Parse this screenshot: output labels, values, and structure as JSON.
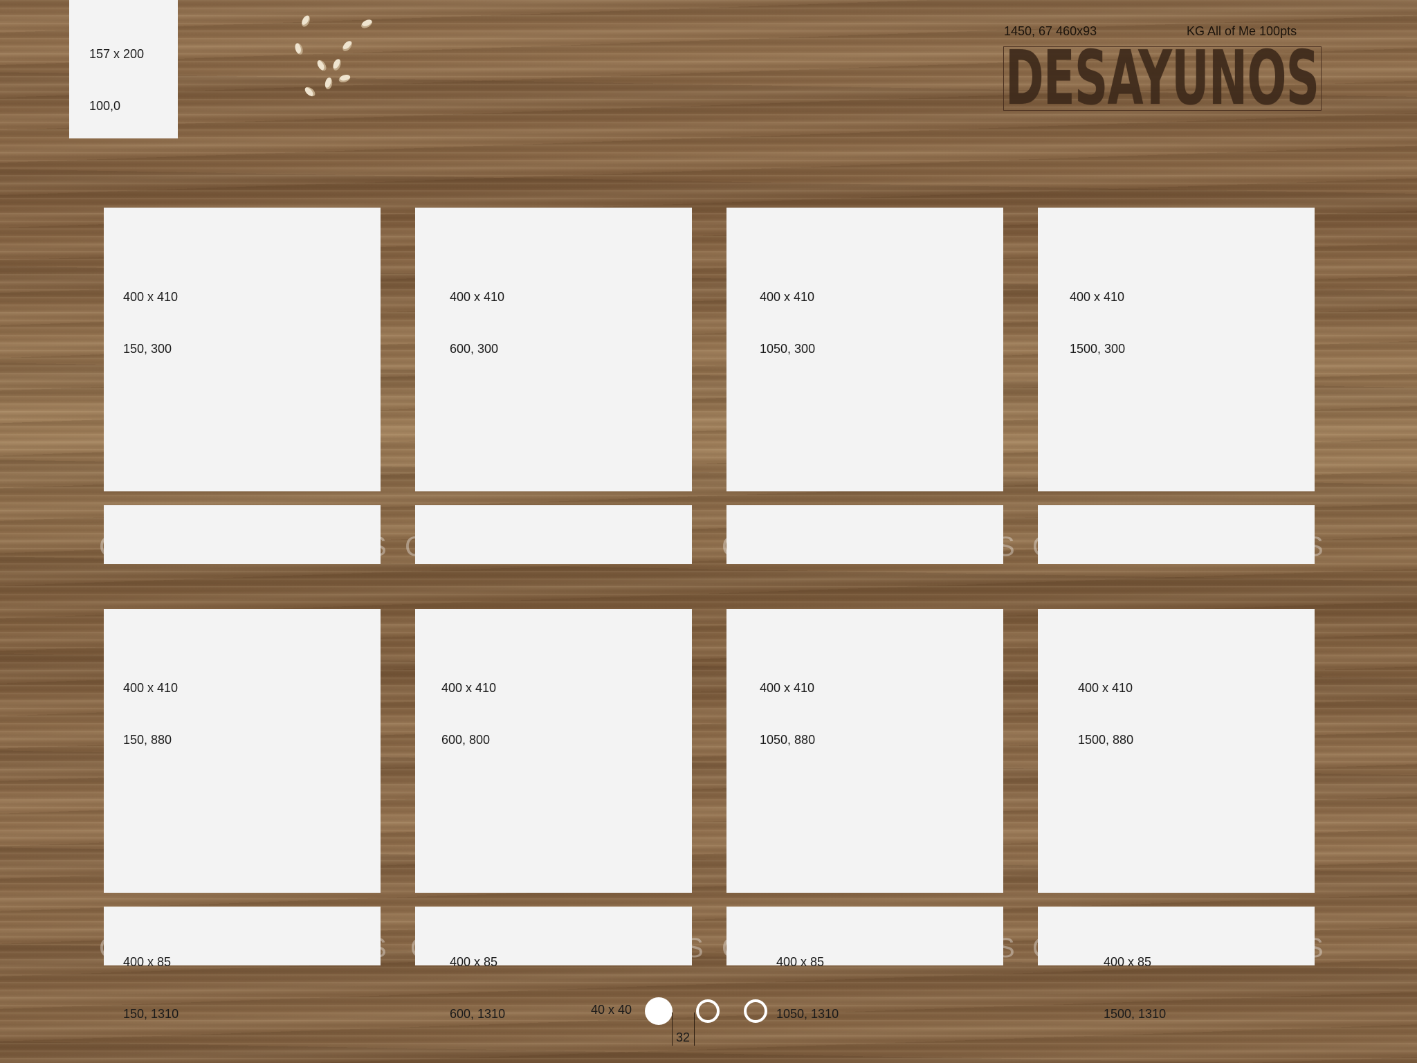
{
  "corner_placeholder": {
    "line1": "157 x 200",
    "line2": "100,0"
  },
  "header": {
    "meta_position": "1450, 67  460x93",
    "meta_font": "KG All of Me 100pts",
    "title": "DESAYUNOS"
  },
  "cards_row1": [
    {
      "size": "400 x 410",
      "pos": "150, 300"
    },
    {
      "size": "400 x 410",
      "pos": "600, 300"
    },
    {
      "size": "400 x 410",
      "pos": "1050, 300"
    },
    {
      "size": "400 x 410",
      "pos": "1500, 300"
    }
  ],
  "cards_row2": [
    {
      "size": "400 x 410",
      "pos": "150, 880"
    },
    {
      "size": "400 x 410",
      "pos": "600, 800"
    },
    {
      "size": "400 x 410",
      "pos": "1050, 880"
    },
    {
      "size": "400 x 410",
      "pos": "1500, 880"
    }
  ],
  "captions_row2": [
    {
      "size": "400 x 85",
      "pos": "150, 1310"
    },
    {
      "size": "400 x 85",
      "pos": "600, 1310"
    },
    {
      "size": "400 x 85",
      "pos": "1050, 1310"
    },
    {
      "size": "400 x 85",
      "pos": "1500, 1310"
    }
  ],
  "pagination": {
    "label": "40 x 40",
    "page_number": "32",
    "pages": 3,
    "active_index": 0
  },
  "colors": {
    "placeholder": "#f3f3f3",
    "title": "#3e2a1b",
    "wood": "#8a6a48"
  }
}
